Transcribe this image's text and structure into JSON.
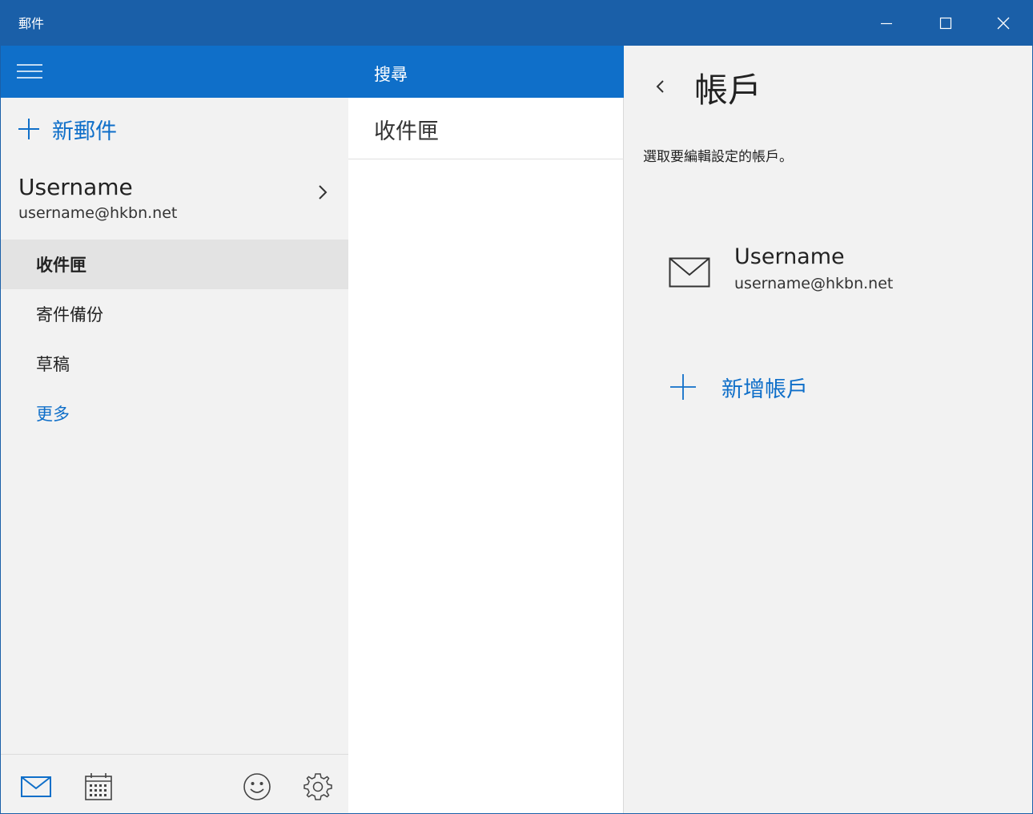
{
  "window": {
    "title": "郵件"
  },
  "nav": {
    "new_mail_label": "新郵件",
    "account": {
      "name": "Username",
      "email": "username@hkbn.net"
    },
    "folders": [
      {
        "label": "收件匣",
        "selected": true
      },
      {
        "label": "寄件備份",
        "selected": false
      },
      {
        "label": "草稿",
        "selected": false
      }
    ],
    "more_label": "更多",
    "footer_icons": [
      "mail-icon",
      "calendar-icon",
      "feedback-smiley-icon",
      "settings-gear-icon"
    ]
  },
  "list": {
    "search_label": "搜尋",
    "folder_title": "收件匣"
  },
  "settings": {
    "title": "帳戶",
    "description": "選取要編輯設定的帳戶。",
    "account": {
      "name": "Username",
      "email": "username@hkbn.net"
    },
    "add_account_label": "新增帳戶"
  },
  "colors": {
    "titlebar": "#1a5fa8",
    "accent": "#0f6fc9",
    "pane_bg": "#f2f2f2",
    "selected_bg": "#e3e3e3"
  }
}
